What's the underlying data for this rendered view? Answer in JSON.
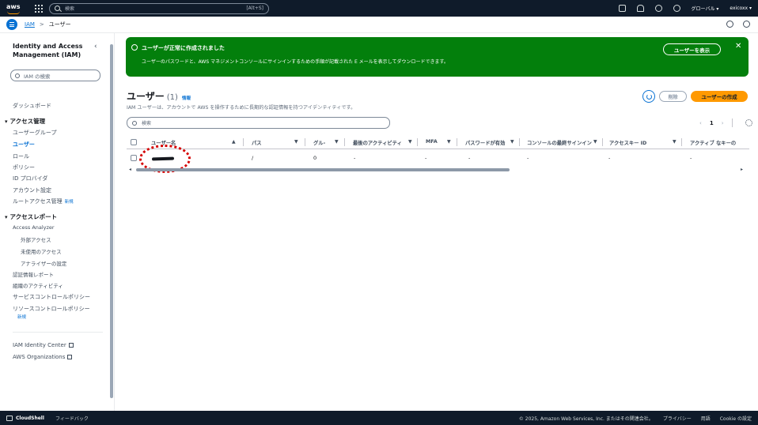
{
  "topnav": {
    "search_placeholder": "検索",
    "search_shortcut": "[Alt+S]",
    "region": "グローバル ▾",
    "account": "exicoxx ▾"
  },
  "breadcrumb": {
    "root": "IAM",
    "separator": ">",
    "current": "ユーザー"
  },
  "sidebar": {
    "title": "Identity and Access Management (IAM)",
    "close_glyph": "‹",
    "search_placeholder": "IAM の検索",
    "dashboard": "ダッシュボード",
    "access_mgmt_header": "アクセス管理",
    "access_mgmt_items": [
      "ユーザーグループ",
      "ユーザー",
      "ロール",
      "ポリシー",
      "ID プロバイダ",
      "アカウント設定",
      "ルートアクセス管理"
    ],
    "new_badge": "新規",
    "access_report_header": "アクセスレポート",
    "access_analyzer": "Access Analyzer",
    "analyzer_items": [
      "外部アクセス",
      "未使用のアクセス",
      "アナライザーの設定"
    ],
    "report_items": [
      "認証情報レポート",
      "組織のアクティビティ",
      "サービスコントロールポリシー",
      "リソースコントロールポリシー"
    ],
    "new_badge2": "新規",
    "external_links": [
      "IAM Identity Center",
      "AWS Organizations"
    ]
  },
  "flash": {
    "title": "ユーザーが正常に作成されました",
    "message": "ユーザーのパスワードと、AWS マネジメントコンソールにサインインするための手順が記載された E メールを表示してダウンロードできます。",
    "button": "ユーザーを表示",
    "close": "✕",
    "color": "#037f0c"
  },
  "page": {
    "title": "ユーザー",
    "count": "(1)",
    "info": "情報",
    "description": "IAM ユーザーは、アカウントで AWS を操作するために長期的な認証情報を持つアイデンティティです。",
    "delete_button": "削除",
    "create_button": "ユーザーの作成",
    "accent": "#ff9900"
  },
  "table": {
    "search_placeholder": "検索",
    "pager": {
      "prev": "‹",
      "page": "1",
      "next": "›"
    },
    "columns": [
      "ユーザー名",
      "パス",
      "グル-",
      "最後のアクティビティ",
      "MFA",
      "パスワードが有効",
      "コンソールの最終サインイン",
      "アクセスキー ID",
      "アクティブ なキーの"
    ],
    "row": {
      "path": "/",
      "groups": "0",
      "last_activity": "-",
      "mfa": "-",
      "password": "-",
      "console_signin": "-",
      "access_key": "-",
      "active_key": "-"
    },
    "scroll_left": "◂",
    "scroll_right": "▸"
  },
  "footer": {
    "cloudshell": "CloudShell",
    "feedback": "フィードバック",
    "copyright": "© 2025, Amazon Web Services, Inc. またはその関連会社。",
    "privacy": "プライバシー",
    "terms": "用語",
    "cookie": "Cookie の設定"
  }
}
